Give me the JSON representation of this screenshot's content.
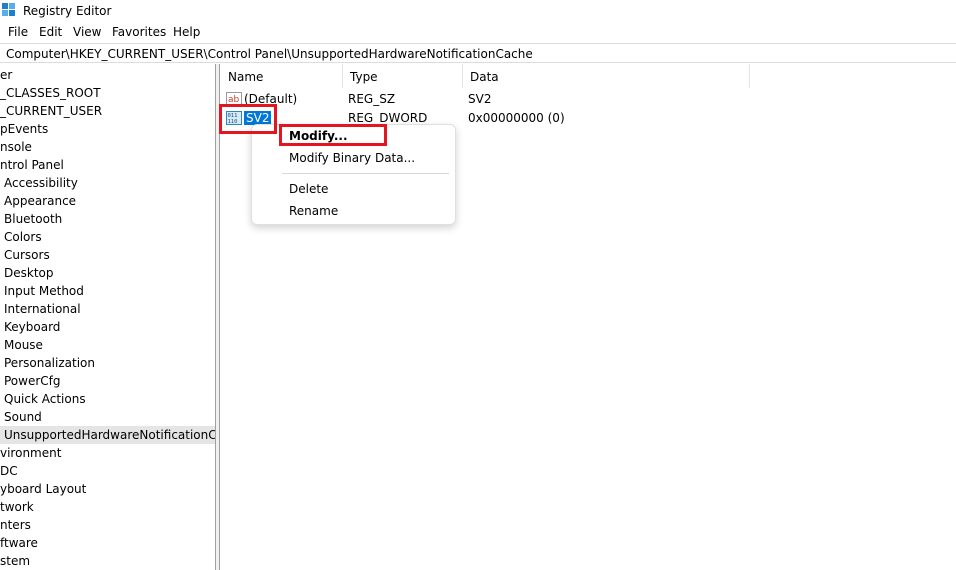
{
  "window": {
    "title": "Registry Editor",
    "icon": "registry-editor-icon"
  },
  "menu": [
    "File",
    "Edit",
    "View",
    "Favorites",
    "Help"
  ],
  "address": "Computer\\HKEY_CURRENT_USER\\Control Panel\\UnsupportedHardwareNotificationCache",
  "tree": {
    "nodes": [
      "er",
      "_CLASSES_ROOT",
      "_CURRENT_USER",
      "pEvents",
      "nsole",
      "ntrol Panel",
      "Accessibility",
      "Appearance",
      "Bluetooth",
      "Colors",
      "Cursors",
      "Desktop",
      "Input Method",
      "International",
      "Keyboard",
      "Mouse",
      "Personalization",
      "PowerCfg",
      "Quick Actions",
      "Sound",
      "UnsupportedHardwareNotificationCach",
      "vironment",
      "DC",
      "yboard Layout",
      "twork",
      "nters",
      "ftware",
      "stem"
    ],
    "selected": "UnsupportedHardwareNotificationCach"
  },
  "list": {
    "columns": [
      "Name",
      "Type",
      "Data"
    ],
    "rows": [
      {
        "name": "(Default)",
        "type": "REG_SZ",
        "data": "SV2",
        "icon": "string-value-icon"
      },
      {
        "name": "SV2",
        "type": "REG_DWORD",
        "data": "0x00000000 (0)",
        "icon": "binary-value-icon"
      }
    ]
  },
  "context_menu": {
    "items": [
      "Modify...",
      "Modify Binary Data...",
      "Delete",
      "Rename"
    ]
  },
  "colors": {
    "highlight_box": "#e3161f",
    "selection": "#0078d7"
  }
}
